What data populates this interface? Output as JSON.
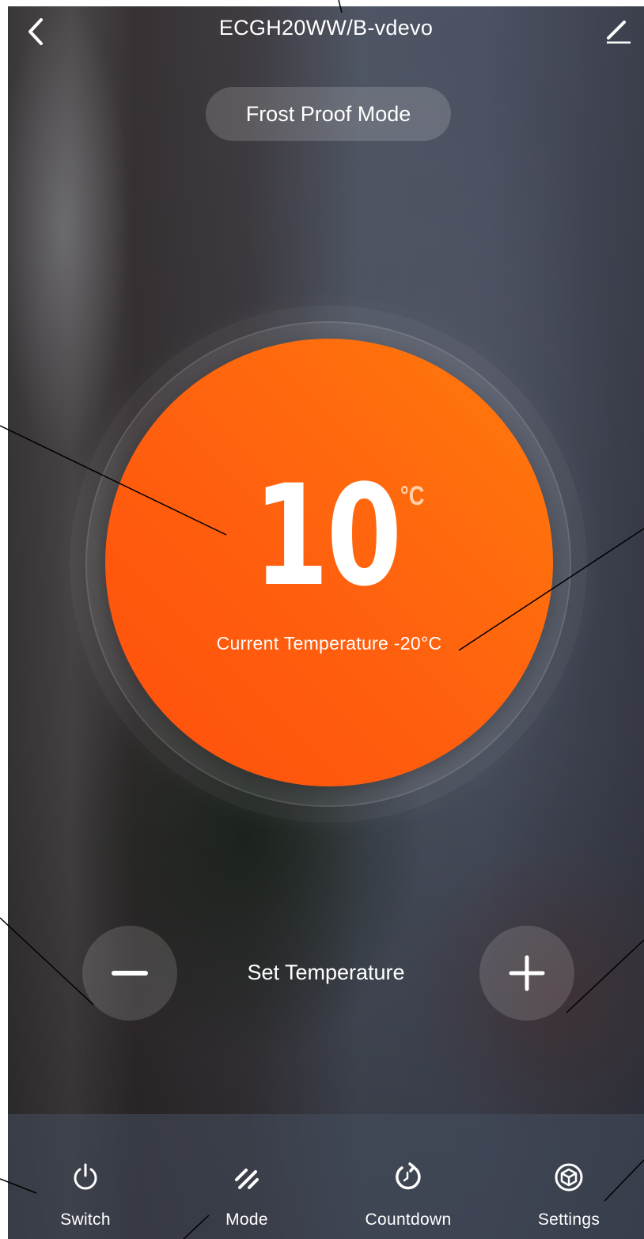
{
  "header": {
    "title": "ECGH20WW/B-vdevo",
    "back_icon": "chevron-left-icon",
    "edit_icon": "pencil-icon"
  },
  "mode_badge": "Frost Proof Mode",
  "dial": {
    "set_value": "10",
    "unit": "°C",
    "current_label": "Current Temperature -20°C",
    "colors": {
      "start": "#ff4f0c",
      "end": "#ff7a0c"
    }
  },
  "controls": {
    "decrease_icon": "minus-icon",
    "increase_icon": "plus-icon",
    "label": "Set Temperature"
  },
  "tabs": [
    {
      "label": "Switch",
      "icon": "power-icon"
    },
    {
      "label": "Mode",
      "icon": "mode-icon"
    },
    {
      "label": "Countdown",
      "icon": "countdown-icon"
    },
    {
      "label": "Settings",
      "icon": "settings-cube-icon"
    }
  ]
}
